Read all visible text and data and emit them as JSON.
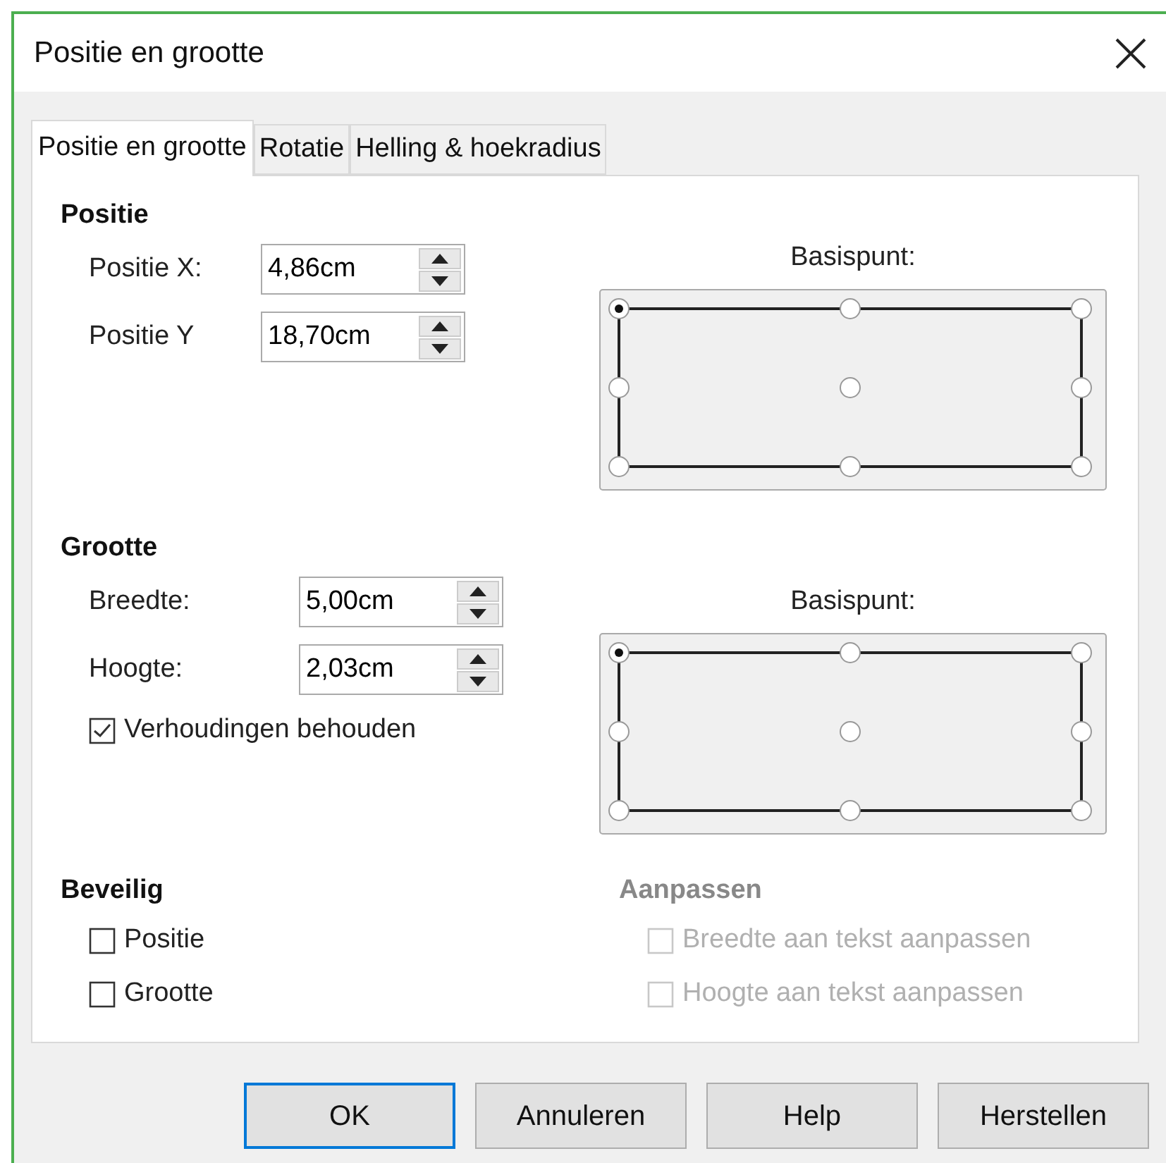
{
  "window": {
    "title": "Positie en grootte"
  },
  "tabs": [
    {
      "label": "Positie en grootte",
      "selected": true
    },
    {
      "label": "Rotatie",
      "selected": false
    },
    {
      "label": "Helling & hoekradius",
      "selected": false
    }
  ],
  "position": {
    "heading": "Positie",
    "fields": [
      {
        "label": "Positie X:",
        "value": "4,86cm"
      },
      {
        "label": "Positie Y",
        "value": "18,70cm"
      }
    ],
    "basis_label": "Basispunt:",
    "basis_points": [
      {
        "selected": true
      },
      {
        "selected": false
      },
      {
        "selected": false
      },
      {
        "selected": false
      },
      {
        "selected": false
      },
      {
        "selected": false
      },
      {
        "selected": false
      },
      {
        "selected": false
      },
      {
        "selected": false
      }
    ]
  },
  "size": {
    "heading": "Grootte",
    "fields": [
      {
        "label": "Breedte:",
        "value": "5,00cm"
      },
      {
        "label": "Hoogte:",
        "value": "2,03cm"
      }
    ],
    "keep_ratio": {
      "label": "Verhoudingen behouden",
      "checked": true,
      "disabled": false
    },
    "basis_label": "Basispunt:",
    "basis_points": [
      {
        "selected": true
      },
      {
        "selected": false
      },
      {
        "selected": false
      },
      {
        "selected": false
      },
      {
        "selected": false
      },
      {
        "selected": false
      },
      {
        "selected": false
      },
      {
        "selected": false
      },
      {
        "selected": false
      }
    ]
  },
  "protect": {
    "heading": "Beveilig",
    "disabled": false,
    "options": [
      {
        "label": "Positie",
        "checked": false,
        "disabled": false
      },
      {
        "label": "Grootte",
        "checked": false,
        "disabled": false
      }
    ]
  },
  "adjust": {
    "heading": "Aanpassen",
    "disabled": true,
    "options": [
      {
        "label": "Breedte aan tekst aanpassen",
        "checked": false,
        "disabled": true
      },
      {
        "label": "Hoogte aan tekst aanpassen",
        "checked": false,
        "disabled": true
      }
    ]
  },
  "buttons": [
    {
      "label": "OK",
      "default": true
    },
    {
      "label": "Annuleren",
      "default": false
    },
    {
      "label": "Help",
      "default": false
    },
    {
      "label": "Herstellen",
      "default": false
    }
  ]
}
